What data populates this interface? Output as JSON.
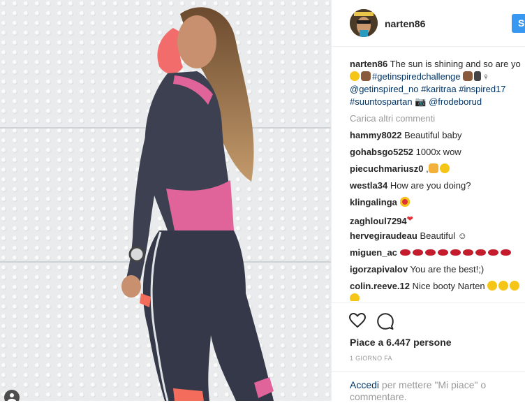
{
  "post": {
    "username": "narten86",
    "follow_label": "Se",
    "caption": {
      "username": "narten86",
      "text_1": " The sun is shining and so are yo",
      "line2_tag1": "#getinspiredchallenge",
      "line3_mention": "@getinspired_no",
      "line3_tag1": "#karitraa",
      "line3_tag2": "#inspired17",
      "line4_tag": "#suuntospartan",
      "line4_mention": "@frodeborud"
    },
    "load_more": "Carica altri commenti",
    "comments": [
      {
        "user": "hammy8022",
        "text": " Beautiful baby"
      },
      {
        "user": "gohabsgo5252",
        "text": " 1000x wow"
      },
      {
        "user": "piecuchmariusz0",
        "text": " ,"
      },
      {
        "user": "westla34",
        "text": " How are you doing?"
      },
      {
        "user": "klingalinga",
        "text": " "
      },
      {
        "user": "zaghloul7294",
        "text": ""
      },
      {
        "user": "hervegiraudeau",
        "text": " Beautiful ☺"
      },
      {
        "user": "miguen_ac",
        "text": " "
      },
      {
        "user": "igorzapivalov",
        "text": " You are the best!;)"
      },
      {
        "user": "colin.reeve.12",
        "text": " Nice booty Narten "
      }
    ],
    "likes": "Piace a 6.447 persone",
    "timestamp": "1 GIORNO FA",
    "login_link": "Accedi",
    "login_text": " per mettere \"Mi piace\" o commentare."
  },
  "colors": {
    "link": "#003569",
    "follow": "#3897f0",
    "muted": "#999999"
  },
  "icons": [
    "heart-icon",
    "comment-icon",
    "tag-icon",
    "avatar"
  ]
}
